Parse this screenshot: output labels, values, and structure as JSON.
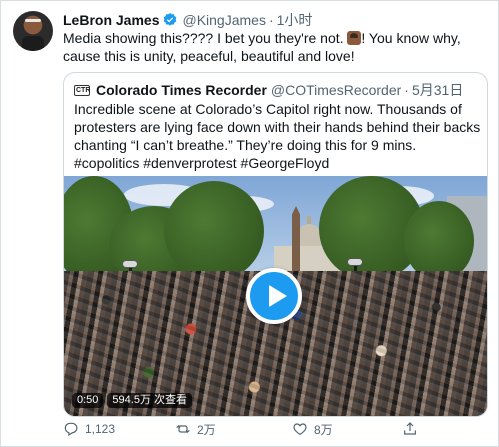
{
  "tweet": {
    "author_name": "LeBron James",
    "author_handle": "@KingJames",
    "separator": "·",
    "time": "1小时",
    "text_before_emoji": "Media showing this???? I bet you they're not. ",
    "text_after_emoji": "! You know why, cause this is unity, peaceful, beautiful and love!",
    "verified_icon": "verified-badge-icon"
  },
  "quoted": {
    "logo_text": "CTR",
    "author_name": "Colorado Times Recorder",
    "author_handle": "@COTimesRecorder",
    "separator": "·",
    "time": "5月31日",
    "text": "Incredible scene at Colorado’s Capitol right now. Thousands of protesters are lying face down with their hands behind their backs chanting “I can’t breathe.” They’re doing this for 9 mins. #copolitics #denverprotest #GeorgeFloyd",
    "video": {
      "duration": "0:50",
      "views": "594.5万 次查看"
    }
  },
  "actions": {
    "reply_count": "1,123",
    "retweet_count": "2万",
    "like_count": "8万",
    "accent_color": "#1d9bf0"
  }
}
